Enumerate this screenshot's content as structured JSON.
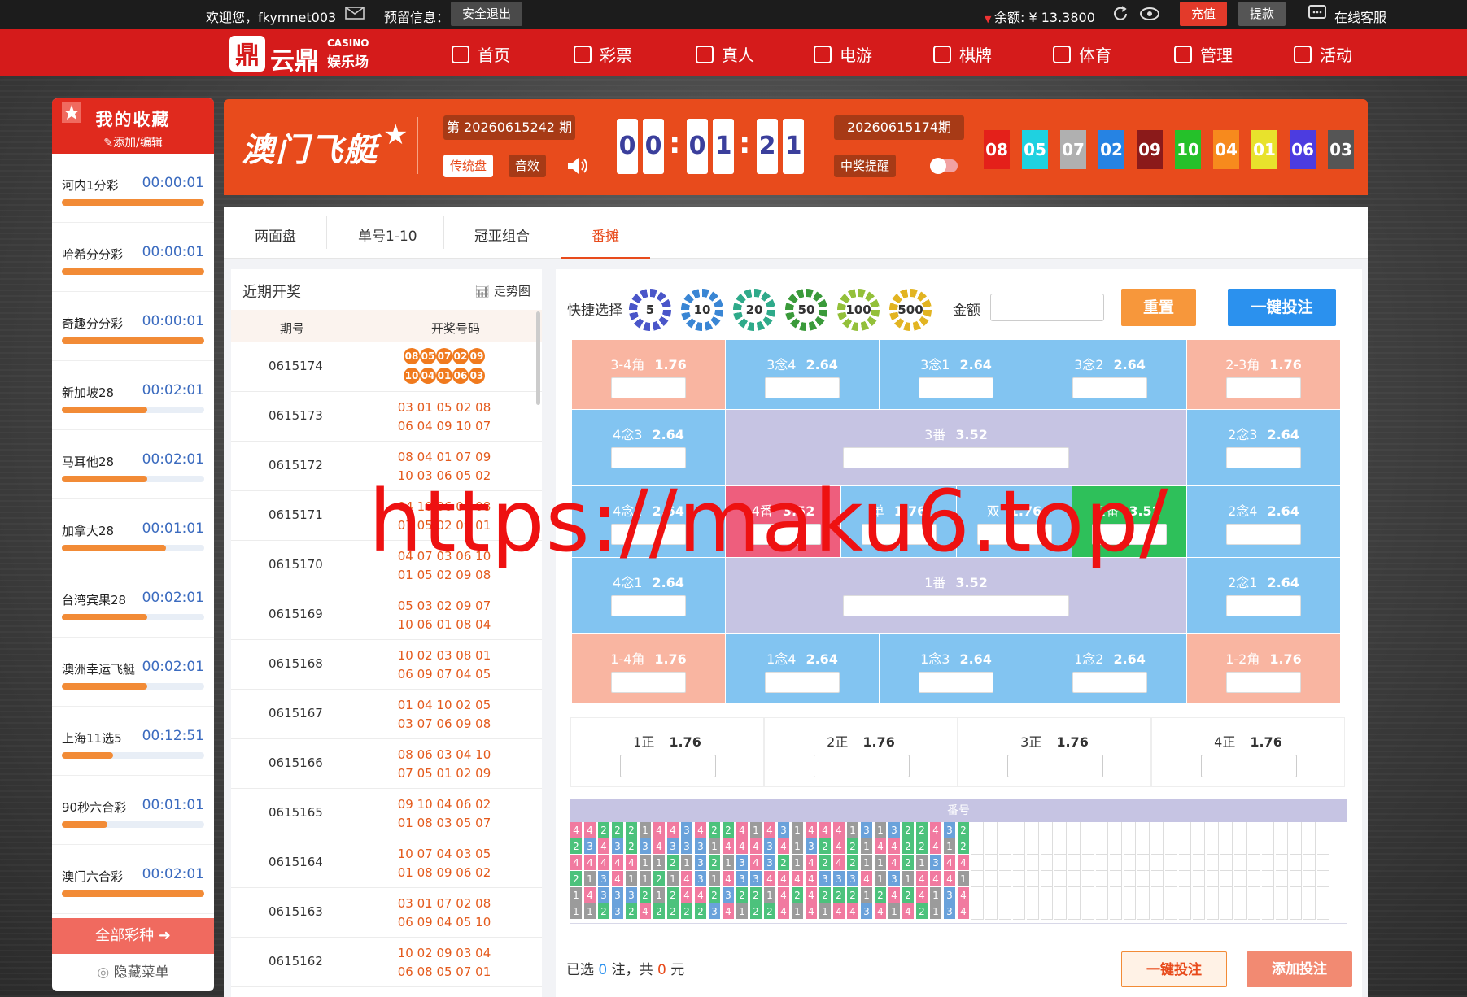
{
  "topbar": {
    "welcome": "欢迎您，fkymnet003",
    "reserved": "预留信息：",
    "logout": "安全退出",
    "balance_label": "余额: ¥ 13.3800",
    "deposit": "充值",
    "withdraw": "提款",
    "service": "在线客服"
  },
  "brand": {
    "name": "云鼎",
    "en": "CASINO",
    "cn": "娱乐场"
  },
  "nav": [
    "首页",
    "彩票",
    "真人",
    "电游",
    "棋牌",
    "体育",
    "管理",
    "活动"
  ],
  "sidebar": {
    "title": "我的收藏",
    "sub": "添加/编辑",
    "all": "全部彩种",
    "hide": "隐藏菜单",
    "items": [
      {
        "name": "河内1分彩",
        "time": "00:00:01",
        "progress": 1.0
      },
      {
        "name": "哈希分分彩",
        "time": "00:00:01",
        "progress": 1.0
      },
      {
        "name": "奇趣分分彩",
        "time": "00:00:01",
        "progress": 1.0
      },
      {
        "name": "新加坡28",
        "time": "00:02:01",
        "progress": 0.6
      },
      {
        "name": "马耳他28",
        "time": "00:02:01",
        "progress": 0.6
      },
      {
        "name": "加拿大28",
        "time": "00:01:01",
        "progress": 0.73
      },
      {
        "name": "台湾宾果28",
        "time": "00:02:01",
        "progress": 0.6
      },
      {
        "name": "澳洲幸运飞艇",
        "time": "00:02:01",
        "progress": 0.6
      },
      {
        "name": "上海11选5",
        "time": "00:12:51",
        "progress": 0.36
      },
      {
        "name": "90秒六合彩",
        "time": "00:01:01",
        "progress": 0.32
      },
      {
        "name": "澳门六合彩",
        "time": "00:02:01",
        "progress": 1.0
      }
    ]
  },
  "lottery": {
    "name": "澳门飞艇",
    "issue": "第 20260615242 期",
    "classic": "传统盘",
    "sound": "音效",
    "timer": [
      "0",
      "0",
      "0",
      "1",
      "2",
      "1"
    ],
    "last_issue": "20260615174期",
    "win_remind": "中奖提醒",
    "balls": [
      {
        "n": "08",
        "c": "#e4201a"
      },
      {
        "n": "05",
        "c": "#1fd1e0"
      },
      {
        "n": "07",
        "c": "#b0b0b0"
      },
      {
        "n": "02",
        "c": "#2683e3"
      },
      {
        "n": "09",
        "c": "#8b1a1a"
      },
      {
        "n": "10",
        "c": "#25c12a"
      },
      {
        "n": "04",
        "c": "#f78a1d"
      },
      {
        "n": "01",
        "c": "#e8e22c"
      },
      {
        "n": "06",
        "c": "#4c3ce0"
      },
      {
        "n": "03",
        "c": "#555555"
      }
    ]
  },
  "tabs": [
    "两面盘",
    "单号1-10",
    "冠亚组合",
    "番摊"
  ],
  "recent": {
    "title": "近期开奖",
    "trend": "走势图",
    "col_issue": "期号",
    "col_nums": "开奖号码",
    "rows": [
      {
        "issue": "0615174",
        "l1": "08 05 07 02 09",
        "l2": "10 04 01 06 03",
        "circles": [
          "08",
          "05",
          "07",
          "02",
          "09",
          "10",
          "04",
          "01",
          "06",
          "03"
        ]
      },
      {
        "issue": "0615173",
        "l1": "03 01 05 02 08",
        "l2": "06 04 09 10 07"
      },
      {
        "issue": "0615172",
        "l1": "08 04 01 07 09",
        "l2": "10 03 06 05 02"
      },
      {
        "issue": "0615171",
        "l1": "04 10 06 03 08",
        "l2": "07 05 02 09 01"
      },
      {
        "issue": "0615170",
        "l1": "04 07 03 06 10",
        "l2": "01 05 02 09 08"
      },
      {
        "issue": "0615169",
        "l1": "05 03 02 09 07",
        "l2": "10 06 01 08 04"
      },
      {
        "issue": "0615168",
        "l1": "10 02 03 08 01",
        "l2": "06 09 07 04 05"
      },
      {
        "issue": "0615167",
        "l1": "01 04 10 02 05",
        "l2": "03 07 06 09 08"
      },
      {
        "issue": "0615166",
        "l1": "08 06 03 04 10",
        "l2": "07 05 01 02 09"
      },
      {
        "issue": "0615165",
        "l1": "09 10 04 06 02",
        "l2": "01 08 03 05 07"
      },
      {
        "issue": "0615164",
        "l1": "10 07 04 03 05",
        "l2": "01 08 09 06 02"
      },
      {
        "issue": "0615163",
        "l1": "03 01 07 02 08",
        "l2": "06 09 04 05 10"
      },
      {
        "issue": "0615162",
        "l1": "10 02 09 03 04",
        "l2": "06 08 05 07 01"
      }
    ]
  },
  "bet": {
    "quick": "快捷选择",
    "chips": [
      "5",
      "10",
      "20",
      "50",
      "100",
      "500"
    ],
    "amount_label": "金额",
    "reset": "重置",
    "oneclick": "一键投注",
    "cells": [
      {
        "k": "3-4角",
        "o": "1.76"
      },
      {
        "k": "3念4",
        "o": "2.64"
      },
      {
        "k": "3念1",
        "o": "2.64"
      },
      {
        "k": "3念2",
        "o": "2.64"
      },
      {
        "k": "2-3角",
        "o": "1.76"
      },
      {
        "k": "4念3",
        "o": "2.64"
      },
      {
        "k": "3番",
        "o": "3.52"
      },
      {
        "k": "2念3",
        "o": "2.64"
      },
      {
        "k": "4念2",
        "o": "2.64"
      },
      {
        "k": "4番",
        "o": "3.52"
      },
      {
        "k": "单",
        "o": "1.76"
      },
      {
        "k": "双",
        "o": "1.76"
      },
      {
        "k": "2番",
        "o": "3.52"
      },
      {
        "k": "2念4",
        "o": "2.64"
      },
      {
        "k": "4念1",
        "o": "2.64"
      },
      {
        "k": "1番",
        "o": "3.52"
      },
      {
        "k": "2念1",
        "o": "2.64"
      },
      {
        "k": "1-4角",
        "o": "1.76"
      },
      {
        "k": "1念4",
        "o": "2.64"
      },
      {
        "k": "1念3",
        "o": "2.64"
      },
      {
        "k": "1念2",
        "o": "2.64"
      },
      {
        "k": "1-2角",
        "o": "1.76"
      }
    ],
    "zheng": [
      {
        "k": "1正",
        "o": "1.76"
      },
      {
        "k": "2正",
        "o": "1.76"
      },
      {
        "k": "3正",
        "o": "1.76"
      },
      {
        "k": "4正",
        "o": "1.76"
      }
    ],
    "road_title": "番号",
    "road": [
      "4422214434224143144413132243 2",
      "2343234333144434132421442241 2",
      "4444411213213432142421142134 4",
      "2134112143143344443334131444 1",
      "1433321244232214242221242413 4",
      "1123242222341224141443414213 4"
    ],
    "selected_pre": "已选",
    "selected_n": "0",
    "zhu": "注，共",
    "amount": "0",
    "yuan": "元",
    "submit": "一键投注",
    "add": "添加投注"
  },
  "watermark": "https://maku6.top/"
}
